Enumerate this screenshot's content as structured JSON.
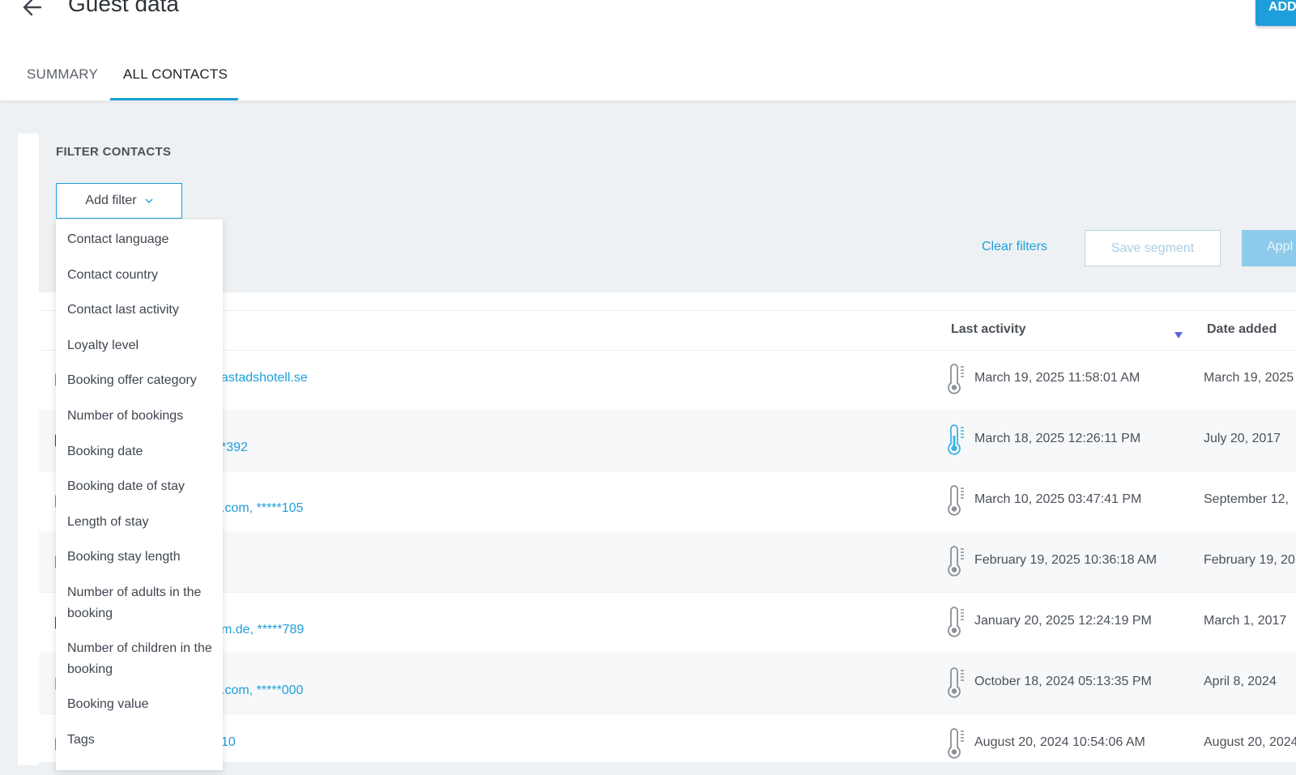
{
  "header": {
    "title": "Guest data",
    "add_button": "ADD"
  },
  "tabs": [
    {
      "label": "SUMMARY",
      "active": false
    },
    {
      "label": "ALL CONTACTS",
      "active": true
    }
  ],
  "filter": {
    "title": "FILTER CONTACTS",
    "add_filter_label": "Add filter",
    "clear_filters": "Clear filters",
    "save_segment": "Save segment",
    "apply": "Appl",
    "menu_items": [
      "Contact language",
      "Contact country",
      "Contact last activity",
      "Loyalty level",
      "Booking offer category",
      "Number of bookings",
      "Booking date",
      "Booking date of stay",
      "Length of stay",
      "Booking stay length",
      "Number of adults in the booking",
      "Number of children in the booking",
      "Booking value",
      "Tags"
    ]
  },
  "table": {
    "columns": {
      "last_activity": "Last activity",
      "date_added": "Date added"
    },
    "rows": [
      {
        "contact": "astadshotell.se",
        "last_activity": "March 19, 2025 11:58:01 AM",
        "date_added": "March 19, 2025",
        "temperature": "cold",
        "dot_color": "#e0684b"
      },
      {
        "contact": "*392",
        "last_activity": "March 18, 2025 12:26:11 PM",
        "date_added": "July 20, 2017",
        "temperature": "active",
        "dot_color": "#3f4650"
      },
      {
        "contact": ".com, *****105",
        "last_activity": "March 10, 2025 03:47:41 PM",
        "date_added": "September 12,",
        "temperature": "cold",
        "dot_color": "#2fb37a"
      },
      {
        "contact": "",
        "last_activity": "February 19, 2025 10:36:18 AM",
        "date_added": "February 19, 20",
        "temperature": "cold",
        "dot_color": "#e0684b"
      },
      {
        "contact": "m.de, *****789",
        "last_activity": "January 20, 2025 12:24:19 PM",
        "date_added": "March 1, 2017",
        "temperature": "cold",
        "dot_color": "#3f4650"
      },
      {
        "contact": ".com, *****000",
        "last_activity": "October 18, 2024 05:13:35 PM",
        "date_added": "April 8, 2024",
        "temperature": "cold",
        "dot_color": "#e0a24b"
      },
      {
        "contact": "10",
        "last_activity": "August 20, 2024 10:54:06 AM",
        "date_added": "August 20, 2024",
        "temperature": "cold",
        "dot_color": "#e0684b"
      }
    ]
  },
  "colors": {
    "accent": "#1e9fdb",
    "thermo_cold": "#8a9096",
    "thermo_active": "#3bb3e6"
  }
}
